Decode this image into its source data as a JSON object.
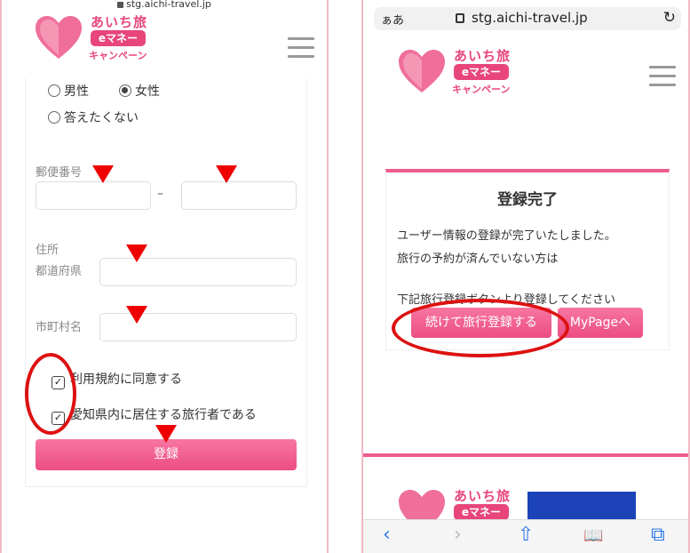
{
  "left": {
    "url": "stg.aichi-travel.jp",
    "logo": {
      "line1": "あいち旅",
      "pill": "eマネー",
      "line2": "キャンペーン"
    },
    "gender": {
      "male": "男性",
      "female": "女性",
      "no_answer": "答えたくない",
      "selected": "female"
    },
    "postal_label": "郵便番号",
    "postal_dash": "–",
    "address_label": "住所",
    "prefecture_label": "都道府県",
    "city_label": "市町村名",
    "terms_label": "利用規約に同意する",
    "resident_label": "愛知県内に居住する旅行者である",
    "register_button": "登録"
  },
  "right": {
    "aa": "ぁあ",
    "url": "stg.aichi-travel.jp",
    "reload": "↻",
    "logo": {
      "line1": "あいち旅",
      "pill": "eマネー",
      "line2": "キャンペーン"
    },
    "done_title": "登録完了",
    "msg1": "ユーザー情報の登録が完了いたしました。",
    "msg2": "旅行の予約が済んでいない方は",
    "msg3": "下記旅行登録ボタンより登録してください",
    "continue_button": "続けて旅行登録する",
    "mypage_button": "MyPageへ",
    "footer_logo": {
      "line1": "あいち旅",
      "pill": "eマネー"
    },
    "toolbar": {
      "back": "‹",
      "forward": "›",
      "share": "⇧",
      "bookmarks": "📖",
      "tabs": "⧉"
    }
  },
  "colors": {
    "accent": "#ec4d83",
    "annotation": "#ee0000",
    "banner": "#1d43b8"
  }
}
